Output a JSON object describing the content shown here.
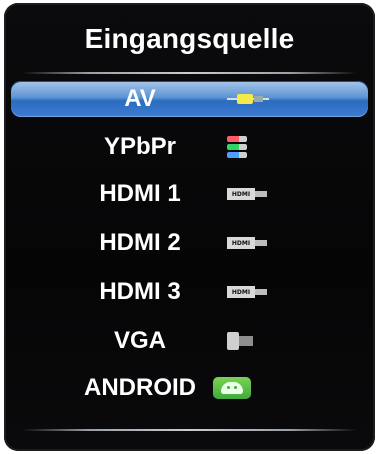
{
  "window": {
    "title": "Eingangsquelle"
  },
  "sources": [
    {
      "label": "AV",
      "selected": true,
      "icon": "composite-av-cable-icon"
    },
    {
      "label": "YPbPr",
      "selected": false,
      "icon": "component-ypbpr-cable-icon"
    },
    {
      "label": "HDMI 1",
      "selected": false,
      "icon": "hdmi-cable-icon",
      "icon_text": "HDMI"
    },
    {
      "label": "HDMI 2",
      "selected": false,
      "icon": "hdmi-cable-icon",
      "icon_text": "HDMI"
    },
    {
      "label": "HDMI 3",
      "selected": false,
      "icon": "hdmi-cable-icon",
      "icon_text": "HDMI"
    },
    {
      "label": "VGA",
      "selected": false,
      "icon": "vga-connector-icon"
    },
    {
      "label": "ANDROID",
      "selected": false,
      "icon": "android-icon"
    }
  ],
  "colors": {
    "selection": "#3c7dd2",
    "panel": "#050506",
    "text": "#ffffff"
  }
}
